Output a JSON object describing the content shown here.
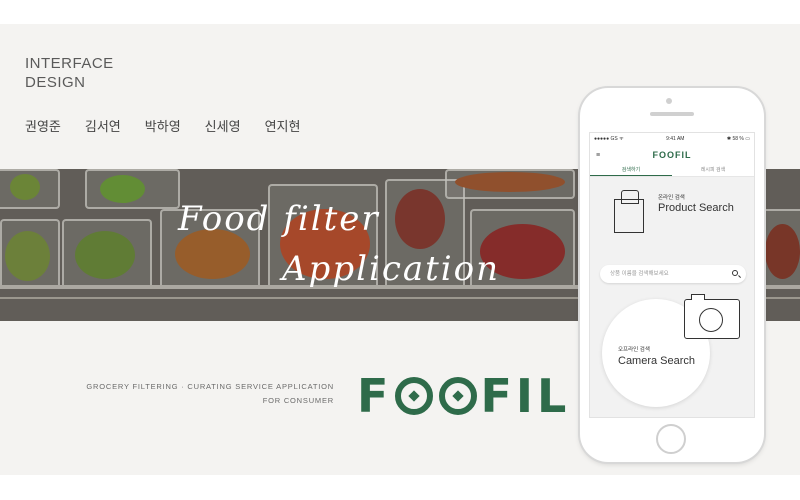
{
  "header": {
    "title_line1": "INTERFACE",
    "title_line2": "DESIGN",
    "team": [
      "권영준",
      "김서연",
      "박하영",
      "신세영",
      "연지현"
    ]
  },
  "banner": {
    "script_line1": "Food filter",
    "script_line2": "Application"
  },
  "branding": {
    "tagline_line1": "GROCERY FILTERING · CURATING SERVICE APPLICATION",
    "tagline_line2": "FOR CONSUMER",
    "logo_part1": "F",
    "logo_part2": "FIL",
    "color": "#2e6b4a"
  },
  "app": {
    "status_left": "●●●●● GS ᯤ",
    "status_time": "9:41 AM",
    "status_right": "✱ 58 % ▭",
    "menu_icon": "≡",
    "title": "FOOFIL",
    "tabs": [
      "검색하기",
      "레시피 검색"
    ],
    "product": {
      "small": "온라인 검색",
      "big": "Product Search"
    },
    "search_placeholder": "상품 이름을 검색해보세요",
    "camera": {
      "small": "오프라인 검색",
      "big": "Camera Search"
    }
  }
}
